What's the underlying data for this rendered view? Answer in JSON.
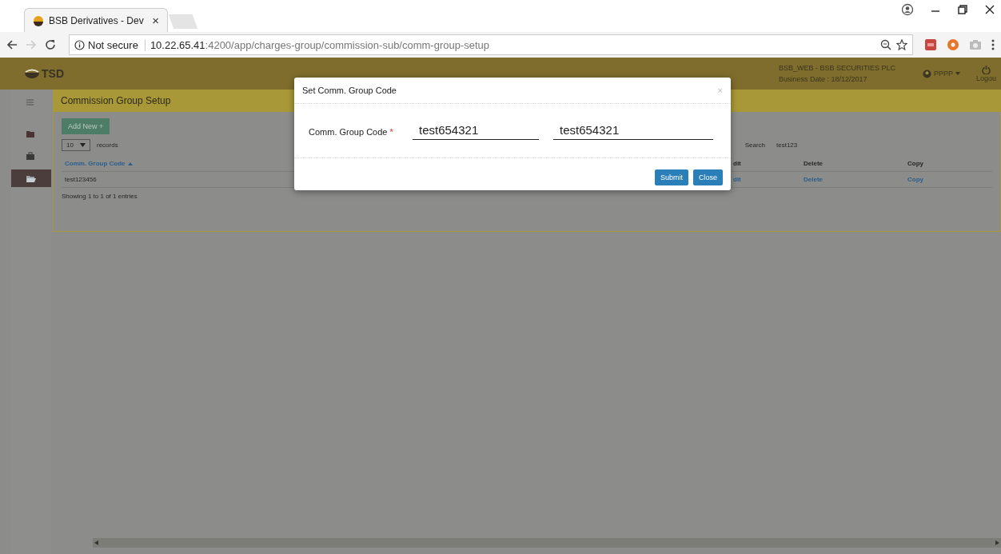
{
  "browser": {
    "tab": {
      "title": "BSB Derivatives - Dev",
      "close": "×"
    },
    "security": "Not secure",
    "url": {
      "host": "10.22.65.41",
      "path": ":4200/app/charges-group/commission-sub/comm-group-setup"
    }
  },
  "header": {
    "logo": "TSD",
    "company": "BSB_WEB - BSB SECURITIES PLC",
    "business_date": "Business Date : 18/12/2017",
    "user": "PPPP",
    "logout": "Logou"
  },
  "sidebar": {
    "items": [
      {
        "kind": "menu",
        "selected": false
      },
      {
        "kind": "folder",
        "selected": false
      },
      {
        "kind": "briefcase",
        "selected": false
      },
      {
        "kind": "folder-open",
        "selected": true
      }
    ]
  },
  "panel": {
    "title": "Commission Group Setup",
    "add_button": "Add New +",
    "page_size": "10",
    "records_label": "records",
    "search": {
      "label": "Search",
      "value": "test123"
    },
    "table": {
      "columns": [
        {
          "label": "Comm. Group Code",
          "sorted": true
        },
        {
          "label": "dit",
          "sorted": false
        },
        {
          "label": "Delete",
          "sorted": false
        },
        {
          "label": "Copy",
          "sorted": false
        }
      ],
      "rows": [
        {
          "cells": [
            {
              "kind": "text",
              "text": "test123456"
            },
            {
              "kind": "link",
              "text": "dit"
            },
            {
              "kind": "link",
              "text": "Delete"
            },
            {
              "kind": "link",
              "text": "Copy"
            }
          ]
        }
      ]
    },
    "info": "Showing 1 to 1 of 1 entries"
  },
  "modal": {
    "title": "Set Comm. Group Code",
    "close": "×",
    "field_label": "Comm. Group Code",
    "required_mark": "*",
    "inputs": [
      "test654321",
      "test654321"
    ],
    "buttons": [
      {
        "label": "Submit"
      },
      {
        "label": "Close"
      }
    ]
  }
}
